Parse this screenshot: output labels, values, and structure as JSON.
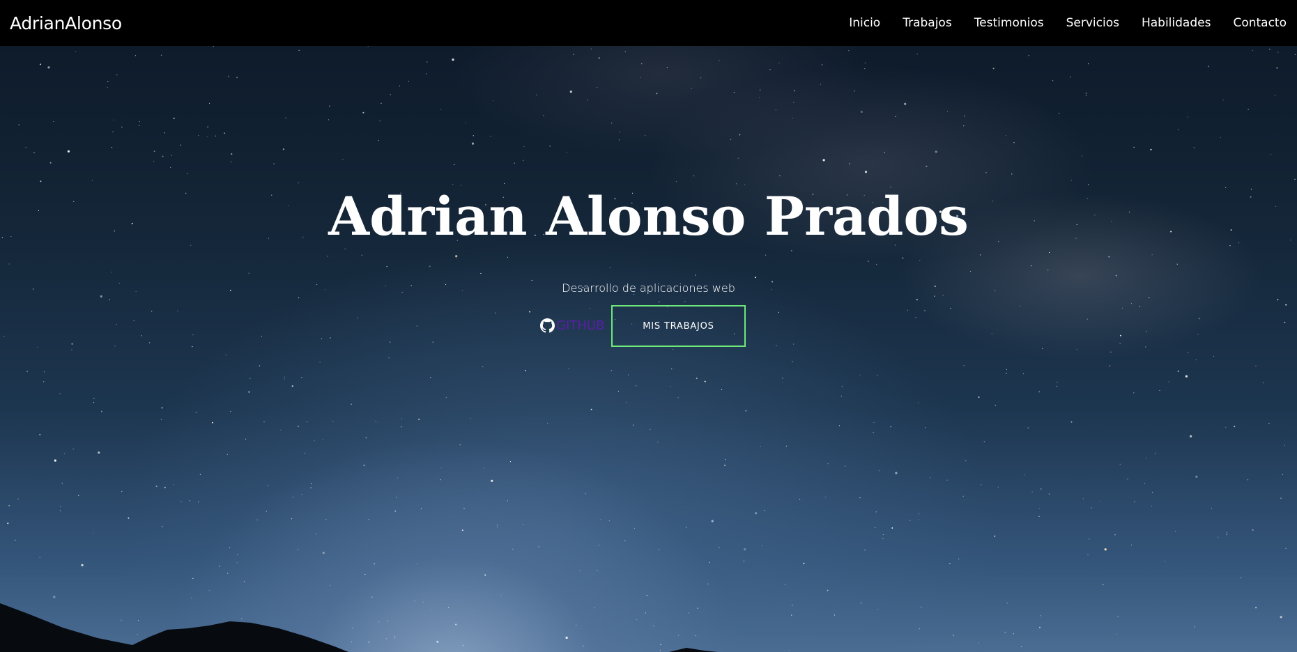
{
  "navbar": {
    "brand": "AdrianAlonso",
    "links": [
      "Inicio",
      "Trabajos",
      "Testimonios",
      "Servicios",
      "Habilidades",
      "Contacto"
    ]
  },
  "hero": {
    "title": "Adrian Alonso Prados",
    "subtitle": "Desarrollo de aplicaciones web",
    "github_label": "GITHUB",
    "github_icon": "github-icon",
    "cta_label": "MIS TRABAJOS"
  },
  "colors": {
    "navbar_bg": "#000000",
    "cta_border": "#6ee87a",
    "github_text": "#5a1ea8",
    "text": "#ffffff"
  }
}
